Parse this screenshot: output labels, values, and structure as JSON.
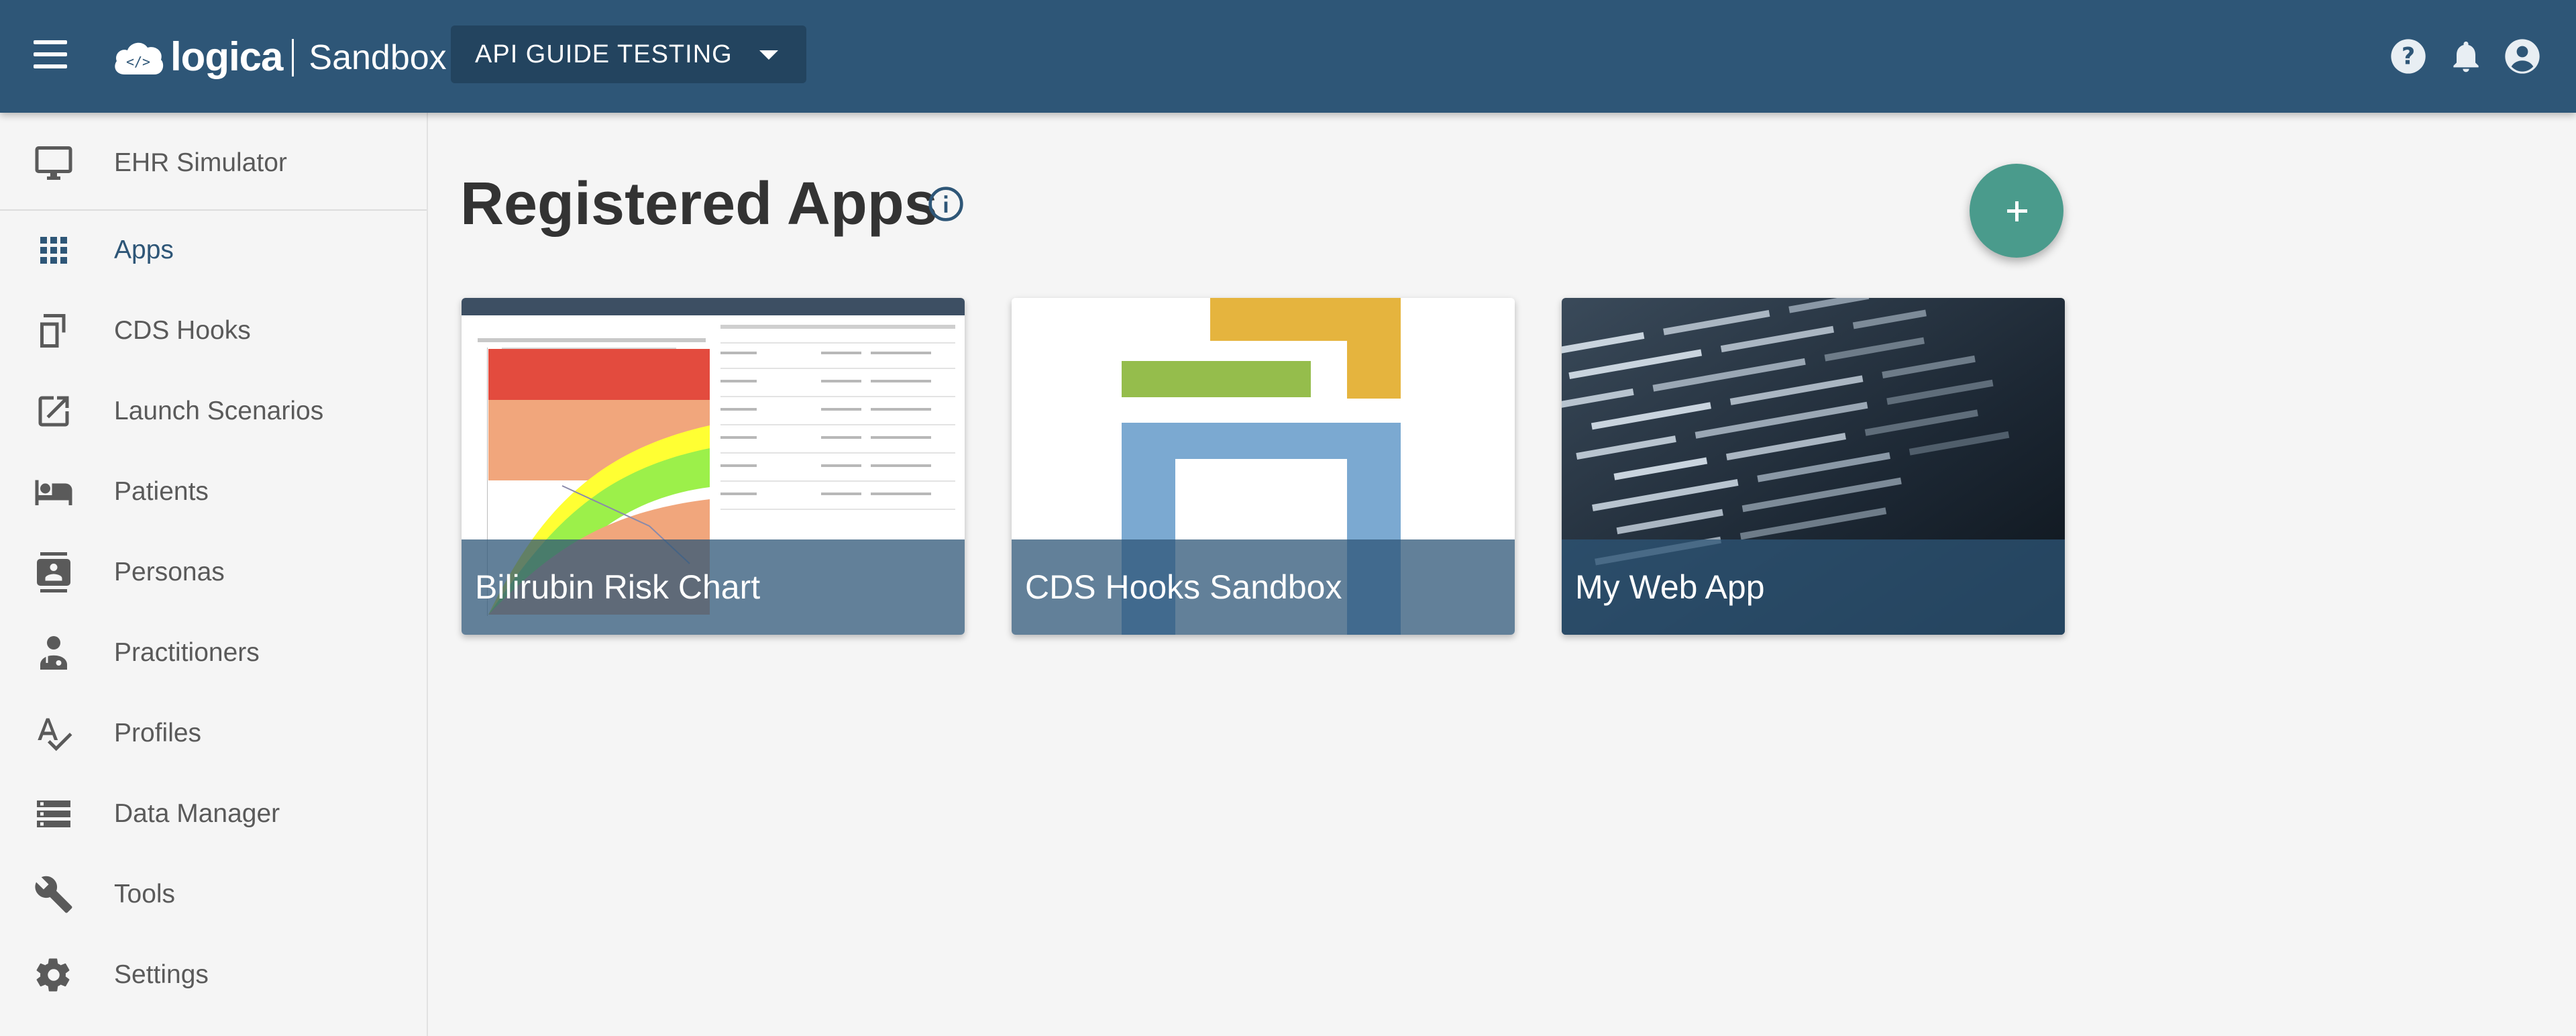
{
  "header": {
    "brand_name": "logica",
    "product_name": "Sandbox",
    "sandbox_selector": {
      "label": "API GUIDE TESTING"
    },
    "icons": [
      "menu-icon",
      "help-icon",
      "notifications-icon",
      "account-icon"
    ]
  },
  "sidebar": {
    "items": [
      {
        "label": "EHR Simulator",
        "icon": "monitor-icon"
      },
      {
        "label": "Apps",
        "icon": "apps-grid-icon",
        "active": true
      },
      {
        "label": "CDS Hooks",
        "icon": "cds-hooks-icon"
      },
      {
        "label": "Launch Scenarios",
        "icon": "launch-icon"
      },
      {
        "label": "Patients",
        "icon": "bed-icon"
      },
      {
        "label": "Personas",
        "icon": "contact-card-icon"
      },
      {
        "label": "Practitioners",
        "icon": "doctor-icon"
      },
      {
        "label": "Profiles",
        "icon": "spellcheck-icon"
      },
      {
        "label": "Data Manager",
        "icon": "storage-icon"
      },
      {
        "label": "Tools",
        "icon": "wrench-icon"
      },
      {
        "label": "Settings",
        "icon": "gear-icon"
      }
    ]
  },
  "main": {
    "title": "Registered Apps",
    "apps": [
      {
        "title": "Bilirubin Risk Chart"
      },
      {
        "title": "CDS Hooks Sandbox"
      },
      {
        "title": "My Web App"
      }
    ]
  },
  "colors": {
    "header_bg": "#2e5677",
    "selector_bg": "#23445f",
    "fab": "#4a9b8c",
    "active_nav": "#2e5677",
    "card_overlay": "#2e5677"
  }
}
